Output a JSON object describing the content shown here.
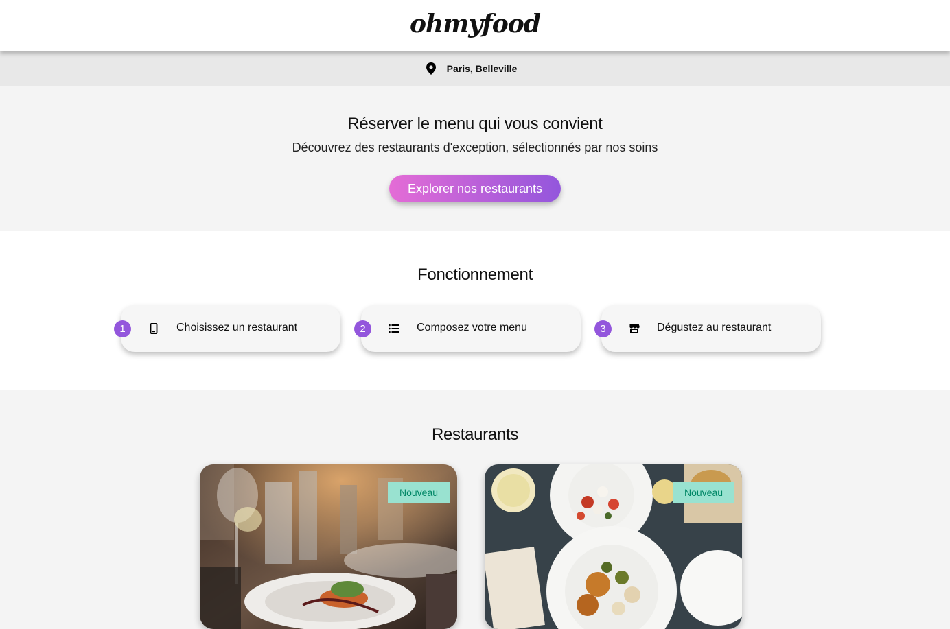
{
  "header": {
    "logo": "ohmyfood"
  },
  "location": {
    "icon": "map-pin-icon",
    "text": "Paris, Belleville"
  },
  "hero": {
    "title": "Réserver le menu qui vous convient",
    "subtitle": "Découvrez des restaurants d'exception, sélectionnés par nos soins",
    "cta_label": "Explorer nos restaurants",
    "cta_gradient": [
      "#e46cd6",
      "#9356dc"
    ]
  },
  "how": {
    "title": "Fonctionnement",
    "steps": [
      {
        "number": "1",
        "icon": "smartphone-icon",
        "label": "Choisissez un restaurant"
      },
      {
        "number": "2",
        "icon": "list-icon",
        "label": "Composez votre menu"
      },
      {
        "number": "3",
        "icon": "store-icon",
        "label": "Dégustez au restaurant"
      }
    ]
  },
  "restaurants": {
    "title": "Restaurants",
    "cards": [
      {
        "badge": "Nouveau",
        "image": "restaurant-table-photo"
      },
      {
        "badge": "Nouveau",
        "image": "food-plates-photo"
      }
    ]
  },
  "colors": {
    "accent": "#9356dc",
    "accent_pink": "#e46cd6",
    "badge_bg": "#99e2d0",
    "badge_text": "#008766"
  }
}
